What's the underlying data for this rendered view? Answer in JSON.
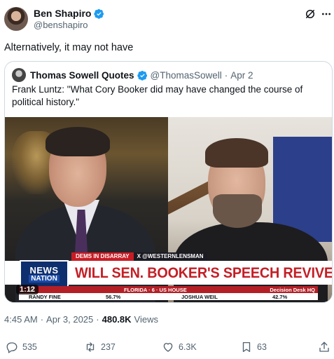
{
  "author": {
    "display_name": "Ben Shapiro",
    "handle": "@benshapiro"
  },
  "tweet": {
    "text": "Alternatively, it may not have"
  },
  "quoted": {
    "display_name": "Thomas Sowell Quotes",
    "handle": "@ThomasSowell",
    "separator": "·",
    "date": "Apr 2",
    "text": "Frank Luntz: \"What Cory Booker did may have changed the course of political history.\""
  },
  "video": {
    "duration": "1:12",
    "chyron_tag": "DEMS IN DISARRAY",
    "chyron_handle": "X @WESTERNLENSMAN",
    "network_line1": "NEWS",
    "network_line2": "NATION",
    "headline": "WILL SEN. BOOKER'S SPEECH REVIVE DEMS?",
    "ticker_left": "IN",
    "ticker_mid": "FLORIDA · 6 · US HOUSE",
    "ticker_right": "Decision Desk HQ",
    "ticker_name1": "RANDY FINE",
    "ticker_pct1": "56.7%",
    "ticker_name2": "JOSHUA WEIL",
    "ticker_pct2": "42.7%"
  },
  "meta": {
    "time": "4:45 AM",
    "dot1": "·",
    "date": "Apr 3, 2025",
    "dot2": "·",
    "views_count": "480.8K",
    "views_label": "Views"
  },
  "actions": {
    "replies": "535",
    "reposts": "237",
    "likes": "6.3K",
    "bookmarks": "63"
  },
  "colors": {
    "verified": "#1d9bf0",
    "secondary_text": "#536471",
    "chyron_red": "#c31f26",
    "network_blue": "#0e2f6e"
  },
  "icons": [
    "verified-badge-icon",
    "grok-icon",
    "more-icon",
    "reply-icon",
    "repost-icon",
    "like-icon",
    "bookmark-icon",
    "share-icon"
  ]
}
